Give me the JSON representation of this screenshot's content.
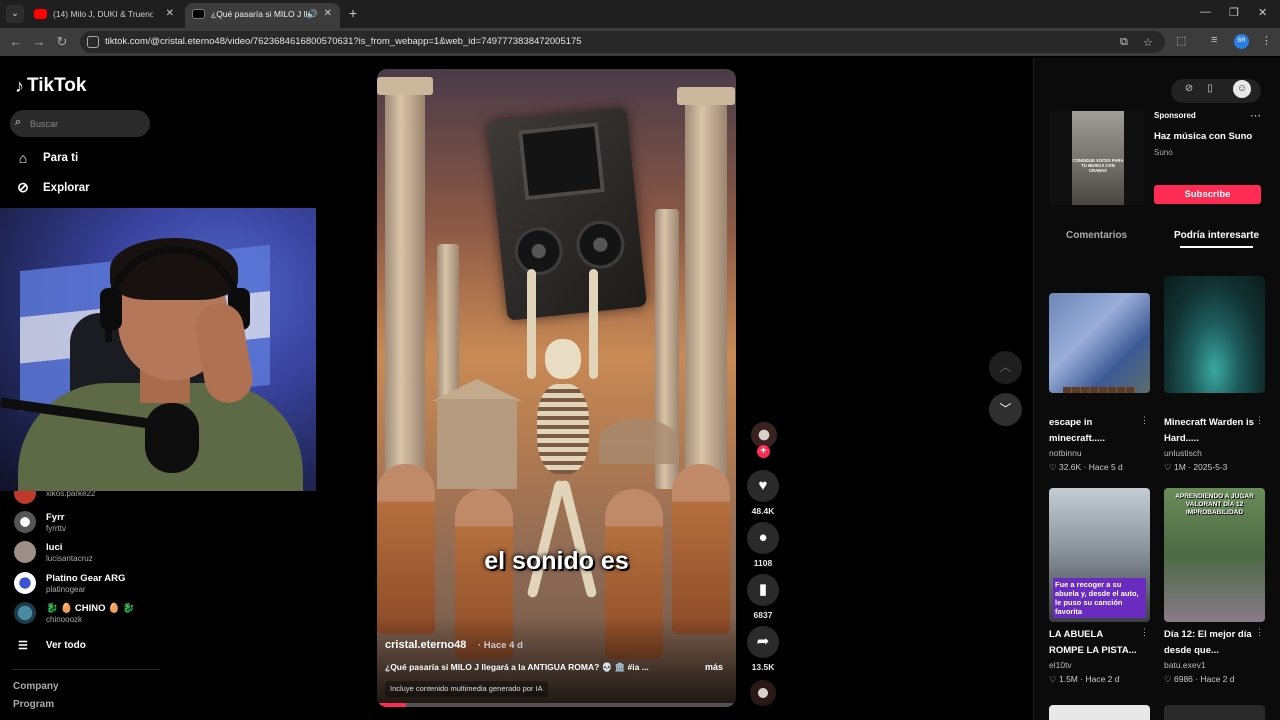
{
  "browser": {
    "tabs": [
      {
        "title": "(14) Milo J, DUKI & Trueno - Pe",
        "active": false
      },
      {
        "title": "¿Qué pasaría si MILO J lleg",
        "active": true
      }
    ],
    "url": "tiktok.com/@cristal.eterno48/video/7623684616800570631?is_from_webapp=1&web_id=7497773838472005175",
    "profile_initials": "BR"
  },
  "sidebar": {
    "logo": "TikTok",
    "search_placeholder": "Buscar",
    "nav": [
      {
        "label": "Para ti",
        "icon": "home-icon"
      },
      {
        "label": "Explorar",
        "icon": "compass-icon"
      }
    ],
    "following": [
      {
        "name": "",
        "handle": "xikos.parke22",
        "color": "#c0392b"
      },
      {
        "name": "Fyrr",
        "handle": "fyrrttv",
        "color": "#e0e0e0"
      },
      {
        "name": "luci",
        "handle": "lucisantacruz",
        "color": "#9b8f88"
      },
      {
        "name": "Platino Gear ARG",
        "handle": "platinogear",
        "color": "#3b52d1"
      },
      {
        "name": "🐉 🥚 CHINO 🥚 🐉",
        "handle": "chinooozk",
        "color": "#4a8aa0"
      }
    ],
    "see_all": "Ver todo",
    "footer": [
      "Company",
      "Program"
    ]
  },
  "video": {
    "overlay_caption": "el sonido es",
    "author": "cristal.eterno48",
    "time": "· Hace 4 d",
    "description": "¿Qué pasaría si MILO J llegará a la ANTIGUA ROMA? 💀 🏛️ #ia ...",
    "more": "más",
    "ai_label": "Incluye contenido multimedia generado por IA",
    "progress": 0.08
  },
  "actions": {
    "likes": "48.4K",
    "comments": "1108",
    "saves": "6837",
    "shares": "13.5K"
  },
  "ad": {
    "sponsored": "Sponsored",
    "title": "Haz música con Suno",
    "brand": "Suno",
    "cta": "Subscribe",
    "thumb_caption": "CONSIGUE VOCES PARA TU MUSICA CON CRABAS"
  },
  "right_tabs": {
    "comments": "Comentarios",
    "suggested": "Podría interesarte"
  },
  "cards": [
    {
      "title": "escape in minecraft.....",
      "author": "notbinnu",
      "likes": "32.6K",
      "age": "Hace 5 d"
    },
    {
      "title": "Minecraft Warden is Hard.....",
      "author": "unlustisch",
      "likes": "1M",
      "age": "2025-5-3"
    },
    {
      "title": "LA ABUELA ROMPE LA PISTA...",
      "author": "el10tv",
      "likes": "1.5M",
      "age": "Hace 2 d",
      "thumb_text": "Fue a recoger a su abuela y, desde el auto, le puso su canción favorita"
    },
    {
      "title": "Día 12: El mejor día desde que...",
      "author": "batu.exev1",
      "likes": "6986",
      "age": "Hace 2 d",
      "thumb_text": "APRENDIENDO A JUGAR VALORANT DÍA 12 IMPROBABILIDAD"
    }
  ],
  "colors": {
    "accent": "#fe2c55",
    "background": "#000000"
  }
}
